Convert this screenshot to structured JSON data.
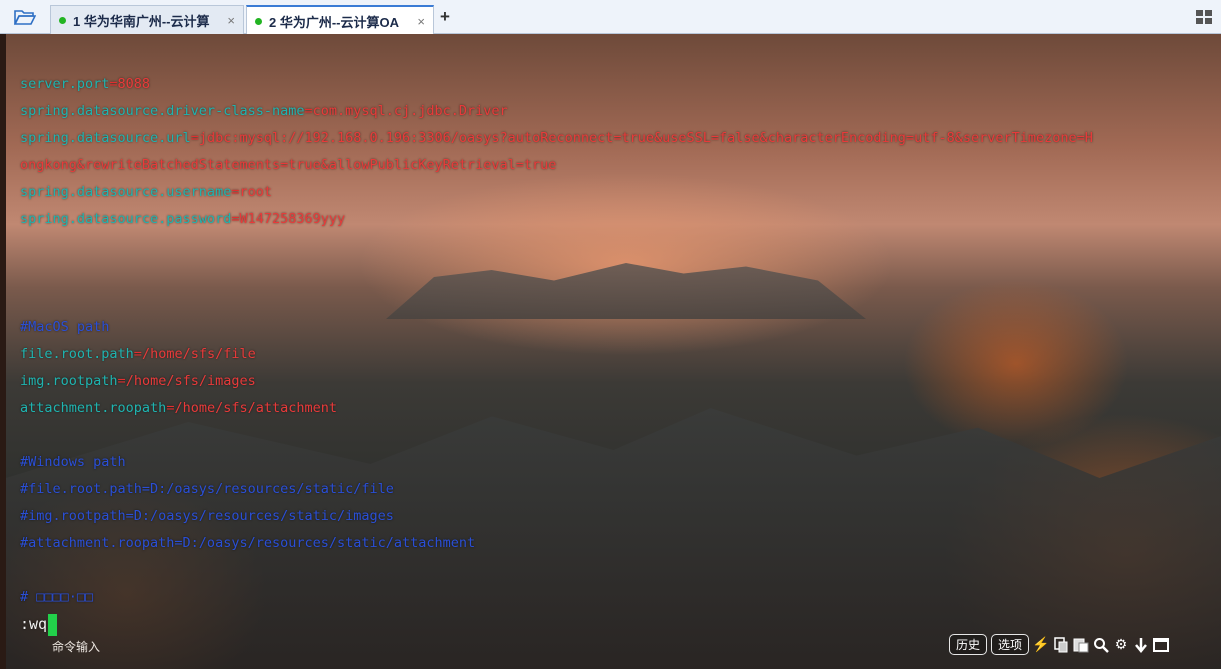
{
  "tabs": [
    {
      "label": "1 华为华南广州--云计算",
      "close": "×",
      "active": false
    },
    {
      "label": "2 华为广州--云计算OA",
      "close": "×",
      "active": true
    }
  ],
  "add_tab": "+",
  "icons": {
    "folder": "folder-open-icon",
    "layout": "grid-layout-icon"
  },
  "terminal": {
    "config": [
      {
        "key": "server.port",
        "eq": "=",
        "value": "8088"
      },
      {
        "key": "spring.datasource.driver-class-name",
        "eq": "=",
        "value": "com.mysql.cj.jdbc.Driver"
      },
      {
        "key": "spring.datasource.url",
        "eq": "=",
        "value": "jdbc:mysql://192.168.0.196:3306/oasys?autoReconnect=true&useSSL=false&characterEncoding=utf-8&serverTimezone=H"
      },
      {
        "key": "",
        "eq": "",
        "value": "ongkong&rewriteBatchedStatements=true&allowPublicKeyRetrieval=true"
      },
      {
        "key": "spring.datasource.username",
        "eq": "=",
        "value": "root"
      },
      {
        "key": "spring.datasource.password",
        "eq": "=",
        "value": "W147258369yyy"
      }
    ],
    "mac_comment": "#MacOS path",
    "mac": [
      {
        "key": "file.root.path",
        "eq": "=",
        "value": "/home/sfs/file"
      },
      {
        "key": "img.rootpath",
        "eq": "=",
        "value": "/home/sfs/images"
      },
      {
        "key": "attachment.roopath",
        "eq": "=",
        "value": "/home/sfs/attachment"
      }
    ],
    "win_comment": "#Windows path",
    "win": [
      "#file.root.path=D:/oasys/resources/static/file",
      "#img.rootpath=D:/oasys/resources/static/images",
      "#attachment.roopath=D:/oasys/resources/static/attachment"
    ],
    "garbled_comment": "# □□□□·□□",
    "command": ":wq"
  },
  "bottom": {
    "command_input": "命令输入",
    "history": "历史",
    "options": "选项"
  },
  "colors": {
    "key": "#1fb4b0",
    "value": "#e83a3a",
    "comment": "#2a4fd6",
    "cursor": "#22d04a"
  }
}
